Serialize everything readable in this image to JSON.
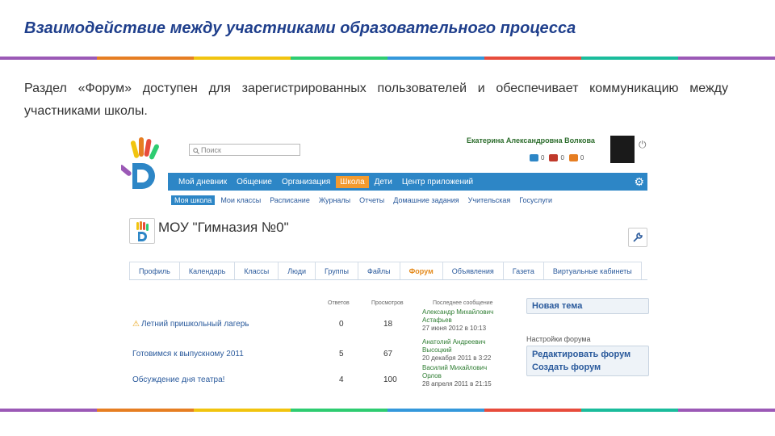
{
  "slide": {
    "title": "Взаимодействие между участниками образовательного процесса",
    "intro": "Раздел «Форум» доступен для зарегистрированных пользователей и обеспечивает коммуникацию между участниками школы.",
    "stripe_colors": [
      "#9b59b6",
      "#e67e22",
      "#f1c40f",
      "#2ecc71",
      "#3498db",
      "#e74c3c",
      "#1abc9c",
      "#9b59b6"
    ]
  },
  "header": {
    "search_placeholder": "Поиск",
    "user_name": "Екатерина Александровна Волкова",
    "counters": [
      {
        "icon": "mail-icon",
        "value": "0",
        "color": "#2d86c6"
      },
      {
        "icon": "friends-icon",
        "value": "0",
        "color": "#c0392b"
      },
      {
        "icon": "invites-icon",
        "value": "0",
        "color": "#e67e22"
      }
    ]
  },
  "topnav": {
    "items": [
      "Мой дневник",
      "Общение",
      "Организация",
      "Школа",
      "Дети",
      "Центр приложений"
    ],
    "active": "Школа"
  },
  "subnav": {
    "items": [
      "Моя школа",
      "Мои классы",
      "Расписание",
      "Журналы",
      "Отчеты",
      "Домашние задания",
      "Учительская",
      "Госуслуги"
    ],
    "active": "Моя школа"
  },
  "school": {
    "name": "МОУ \"Гимназия №0\""
  },
  "tabs": {
    "items": [
      "Профиль",
      "Календарь",
      "Классы",
      "Люди",
      "Группы",
      "Файлы",
      "Форум",
      "Объявления",
      "Газета",
      "Виртуальные кабинеты"
    ],
    "active": "Форум"
  },
  "forum": {
    "columns": {
      "topics": "Ответов",
      "views": "Просмотров",
      "last": "Последнее сообщение"
    },
    "rows": [
      {
        "title": "Летний пришкольный лагерь",
        "warning": true,
        "replies": "0",
        "views": "18",
        "author": "Александр Михайлович Астафьев",
        "date": "27 июня 2012 в 10:13"
      },
      {
        "title": "Готовимся к выпускному 2011",
        "warning": false,
        "replies": "5",
        "views": "67",
        "author": "Анатолий Андреевич Высоцкий",
        "date": "20 декабря 2011 в 3:22"
      },
      {
        "title": "Обсуждение дня театра!",
        "warning": false,
        "replies": "4",
        "views": "100",
        "author": "Василий Михайлович Орлов",
        "date": "28 апреля 2011 в 21:15"
      }
    ]
  },
  "sidebar": {
    "new_topic": "Новая тема",
    "settings_label": "Настройки форума",
    "edit_forum": "Редактировать форум",
    "create_forum": "Создать форум"
  }
}
